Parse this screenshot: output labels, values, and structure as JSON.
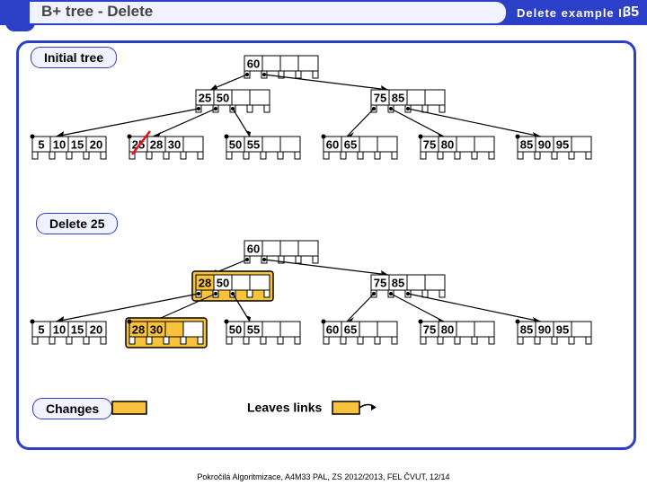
{
  "header": {
    "title": "B+ tree - Delete",
    "subtitle": "Delete example II",
    "page": "35"
  },
  "labels": {
    "initial": "Initial tree",
    "delete25": "Delete 25",
    "changes": "Changes",
    "leaves": "Leaves links"
  },
  "tree1": {
    "root": [
      "60",
      "",
      "",
      ""
    ],
    "int": [
      [
        "25",
        "50",
        "",
        ""
      ],
      [
        "75",
        "85",
        "",
        ""
      ]
    ],
    "leaves": [
      [
        "5",
        "10",
        "15",
        "20"
      ],
      [
        "25",
        "28",
        "30",
        ""
      ],
      [
        "50",
        "55",
        "",
        ""
      ],
      [
        "60",
        "65",
        "",
        ""
      ],
      [
        "75",
        "80",
        "",
        ""
      ],
      [
        "85",
        "90",
        "95",
        ""
      ]
    ]
  },
  "tree2": {
    "root": [
      "60",
      "",
      "",
      ""
    ],
    "int": [
      [
        "28",
        "50",
        "",
        ""
      ],
      [
        "75",
        "85",
        "",
        ""
      ]
    ],
    "leaves": [
      [
        "5",
        "10",
        "15",
        "20"
      ],
      [
        "28",
        "30",
        "",
        ""
      ],
      [
        "50",
        "55",
        "",
        ""
      ],
      [
        "60",
        "65",
        "",
        ""
      ],
      [
        "75",
        "80",
        "",
        ""
      ],
      [
        "85",
        "90",
        "95",
        ""
      ]
    ]
  },
  "footer": "Pokročilá Algoritmizace, A4M33 PAL, ZS 2012/2013, FEL ČVUT, 12/14"
}
